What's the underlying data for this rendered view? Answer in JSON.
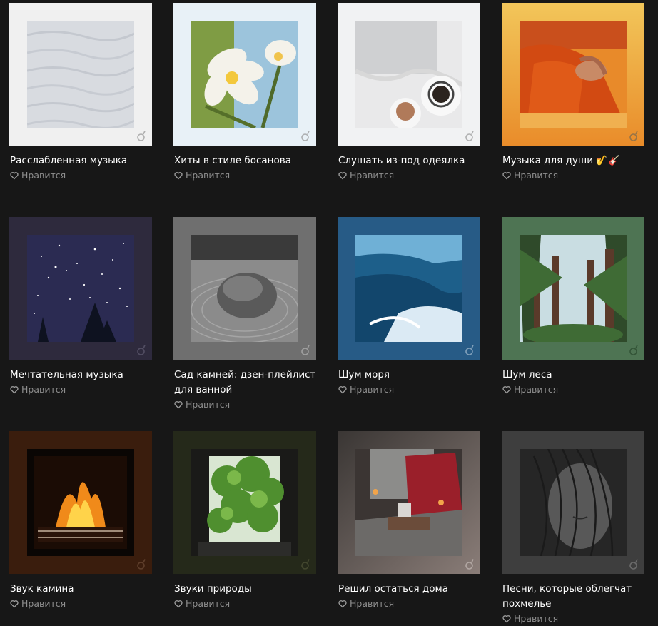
{
  "like_label": "Нравится",
  "badge_icon": "music-note-icon",
  "like_icon": "heart-icon",
  "playlists": [
    {
      "title": "Расслабленная музыка",
      "bg": "#f0f0f0"
    },
    {
      "title": "Хиты в стиле босанова",
      "bg": "#e8f1f7"
    },
    {
      "title": "Слушать из-под одеялка",
      "bg": "#f1f2f3"
    },
    {
      "title": "Музыка для души 🎷🎸",
      "bg": "#f2b13a"
    },
    {
      "title": "Мечтательная музыка",
      "bg": "#2e2a3d"
    },
    {
      "title": "Сад камней: дзен-плейлист для ванной",
      "bg": "#6f6f6f"
    },
    {
      "title": "Шум моря",
      "bg": "#275b86"
    },
    {
      "title": "Шум леса",
      "bg": "#4e7453"
    },
    {
      "title": "Звук камина",
      "bg": "#3a1d0d"
    },
    {
      "title": "Звуки природы",
      "bg": "#25291a"
    },
    {
      "title": "Решил остаться дома",
      "bg": "#6c6562"
    },
    {
      "title": "Песни, которые облегчат похмелье",
      "bg": "#3e3e3e"
    }
  ]
}
